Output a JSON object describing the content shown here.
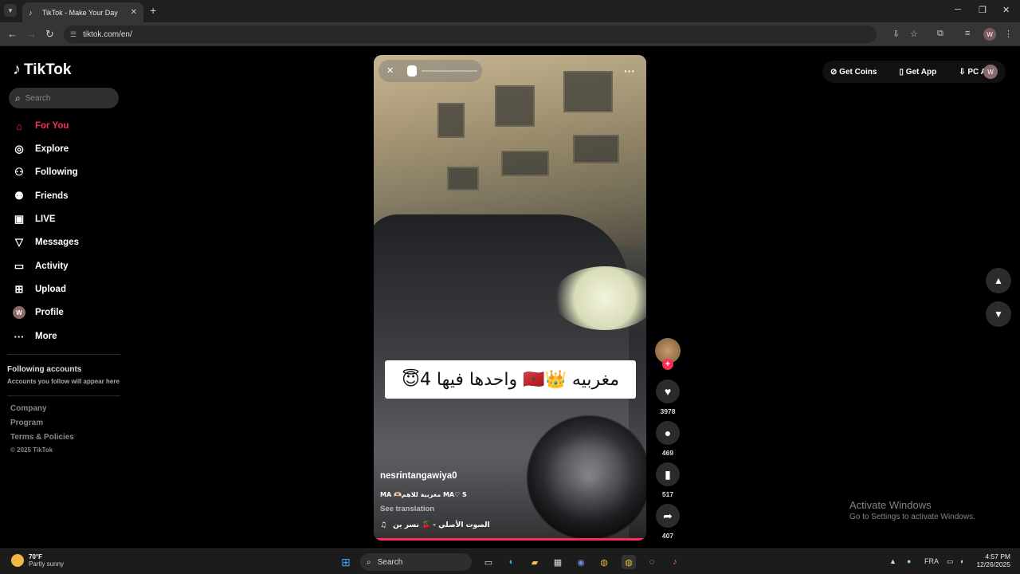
{
  "browser": {
    "tab_title": "TikTok - Make Your Day",
    "url": "tiktok.com/en/",
    "profile_initial": "W"
  },
  "sidebar": {
    "logo_text": "TikTok",
    "search_placeholder": "Search",
    "items": [
      {
        "label": "For You",
        "icon": "home-icon"
      },
      {
        "label": "Explore",
        "icon": "compass-icon"
      },
      {
        "label": "Following",
        "icon": "following-icon"
      },
      {
        "label": "Friends",
        "icon": "friends-icon"
      },
      {
        "label": "LIVE",
        "icon": "live-icon"
      },
      {
        "label": "Messages",
        "icon": "messages-icon"
      },
      {
        "label": "Activity",
        "icon": "activity-icon"
      },
      {
        "label": "Upload",
        "icon": "upload-icon"
      },
      {
        "label": "Profile",
        "icon": "profile-icon"
      },
      {
        "label": "More",
        "icon": "more-icon"
      }
    ],
    "following_accounts_title": "Following accounts",
    "following_accounts_sub": "Accounts you follow will appear here",
    "footer_links": [
      "Company",
      "Program",
      "Terms & Policies"
    ],
    "copyright": "© 2025 TikTok"
  },
  "video": {
    "caption_overlay": "مغربيه 👑🇲🇦 واحدها فيها 4😇",
    "username": "nesrintangawiya0",
    "description": "MA 🫶🏻مغربية للاهم MA♡ S",
    "see_translation": "See translation",
    "music": "الصوت الأصلي - 🍒 نسر ين",
    "music_icon": "♫"
  },
  "actions": {
    "likes": "3978",
    "comments": "469",
    "saves": "517",
    "shares": "407"
  },
  "topbar": {
    "get_coins": "Get Coins",
    "get_app": "Get App",
    "pc_app": "PC App",
    "user_initial": "W"
  },
  "activate": {
    "title": "Activate Windows",
    "subtitle": "Go to Settings to activate Windows."
  },
  "taskbar": {
    "temperature": "70°F",
    "weather": "Partly sunny",
    "search": "Search",
    "language": "FRA",
    "time": "4:57 PM",
    "date": "12/26/2025"
  },
  "colors": {
    "accent": "#fe2c55"
  }
}
